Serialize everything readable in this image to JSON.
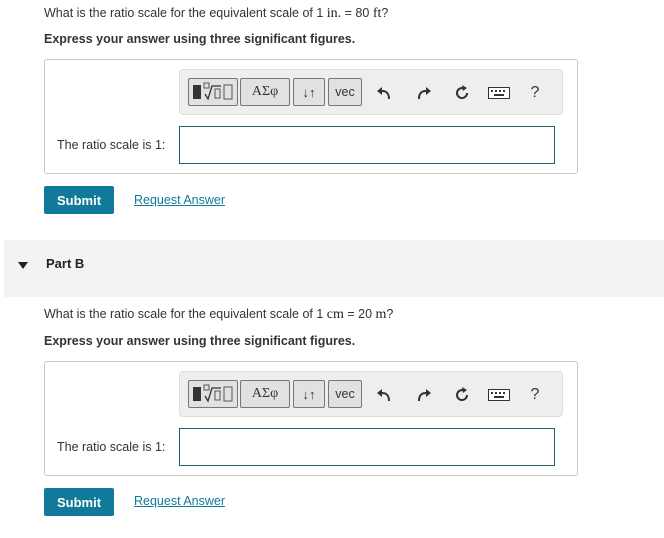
{
  "part_a": {
    "question_prefix": "What is the ratio scale for the equivalent scale of 1 ",
    "unit_a": "in.",
    "question_mid": " = 80 ",
    "unit_b": "ft",
    "question_suffix": "?",
    "instruction": "Express your answer using three significant figures.",
    "answer_label": "The ratio scale is 1:",
    "answer_value": "",
    "submit_label": "Submit",
    "request_label": "Request Answer"
  },
  "part_b": {
    "header": "Part B",
    "question_prefix": "What is the ratio scale for the equivalent scale of 1 ",
    "unit_a": "cm",
    "question_mid": " = 20 ",
    "unit_b": "m",
    "question_suffix": "?",
    "instruction": "Express your answer using three significant figures.",
    "answer_label": "The ratio scale is 1:",
    "answer_value": "",
    "submit_label": "Submit",
    "request_label": "Request Answer"
  },
  "toolbar": {
    "greek_label": "ΑΣφ",
    "arrows_label": "↓↑",
    "vec_label": "vec",
    "help_label": "?",
    "icons": [
      "templates-icon",
      "greek-icon",
      "arrows-icon",
      "vec-icon",
      "undo-icon",
      "redo-icon",
      "reset-icon",
      "keyboard-icon",
      "help-icon"
    ]
  },
  "colors": {
    "accent": "#117a9a",
    "field_border": "#2b5d6e",
    "part_bar": "#f3f3f3"
  }
}
